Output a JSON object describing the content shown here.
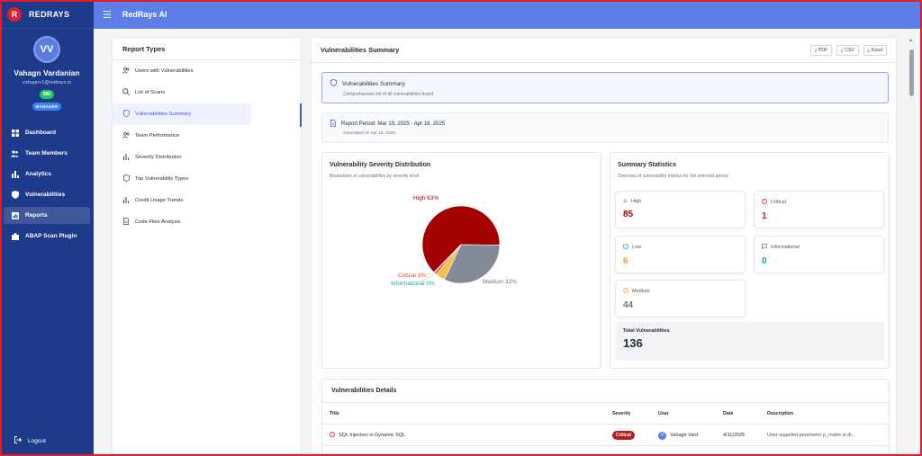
{
  "brand": {
    "logo_letter": "R",
    "name": "REDRAYS"
  },
  "topbar": {
    "title": "RedRays AI"
  },
  "user": {
    "initials": "VV",
    "name": "Vahagn Vardanian",
    "email": "vahagn+1@redrays.io",
    "badge": "S82",
    "role": "MANAGER"
  },
  "sidebar": {
    "items": [
      {
        "label": "Dashboard",
        "icon": "grid-icon"
      },
      {
        "label": "Team Members",
        "icon": "users-icon"
      },
      {
        "label": "Analytics",
        "icon": "bar-chart-icon"
      },
      {
        "label": "Vulnerabilities",
        "icon": "shield-icon"
      },
      {
        "label": "Reports",
        "icon": "report-icon"
      },
      {
        "label": "ABAP Scan Plugin",
        "icon": "puzzle-icon"
      }
    ],
    "logout": "Logout"
  },
  "report_types": {
    "title": "Report Types",
    "items": [
      {
        "label": "Users with Vulnerabilities",
        "icon": "users-icon"
      },
      {
        "label": "List of Scans",
        "icon": "search-icon"
      },
      {
        "label": "Vulnerabilities Summary",
        "icon": "shield-icon"
      },
      {
        "label": "Team Performance",
        "icon": "users-icon"
      },
      {
        "label": "Severity Distribution",
        "icon": "bar-chart-icon"
      },
      {
        "label": "Top Vulnerability Types",
        "icon": "shield-icon"
      },
      {
        "label": "Credit Usage Trends",
        "icon": "bar-chart-icon"
      },
      {
        "label": "Code Files Analysis",
        "icon": "file-icon"
      }
    ]
  },
  "main": {
    "title": "Vulnerabilities Summary",
    "exports": [
      "PDF",
      "CSV",
      "Excel"
    ],
    "info": {
      "title": "Vulnerabilities Summary",
      "subtitle": "Comprehensive list of all vulnerabilities found"
    },
    "period": {
      "title": "Report Period: Mar 19, 2025 - Apr 18, 2025",
      "generated": "Generated on Apr 18, 2025"
    }
  },
  "chart_card": {
    "title": "Vulnerability Severity Distribution",
    "subtitle": "Breakdown of vulnerabilities by severity level."
  },
  "chart_data": {
    "type": "pie",
    "slices": [
      {
        "label": "High 63%",
        "value": 63,
        "color": "#a30000"
      },
      {
        "label": "Medium 32%",
        "value": 32,
        "color": "#858a99"
      },
      {
        "label": "Low",
        "value": 4,
        "color": "#f5c04a"
      },
      {
        "label": "Critical 1%",
        "value": 1,
        "color": "#e53e3e"
      },
      {
        "label": "Informational 0%",
        "value": 0.3,
        "color": "#17a2b8"
      }
    ]
  },
  "stats": {
    "title": "Summary Statistics",
    "subtitle": "Overview of vulnerability metrics for the selected period.",
    "items": [
      {
        "label": "High",
        "value": "85",
        "color": "#a30000",
        "icon": "warning-icon"
      },
      {
        "label": "Critical",
        "value": "1",
        "color": "#b91c1c",
        "icon": "alert-circle-icon"
      },
      {
        "label": "Low",
        "value": "6",
        "color": "#e8a317",
        "icon": "info-icon"
      },
      {
        "label": "Informational",
        "value": "0",
        "color": "#17a2b8",
        "icon": "message-icon"
      },
      {
        "label": "Medium",
        "value": "44",
        "color": "#6b7280",
        "icon": "alert-circle-icon"
      }
    ],
    "total_label": "Total Vulnerabilities",
    "total_value": "136"
  },
  "details": {
    "title": "Vulnerabilities Details",
    "headers": [
      "Title",
      "Severity",
      "User",
      "Date",
      "Description"
    ],
    "rows": [
      {
        "title": "SQL Injection in Dynamic SQL",
        "severity": "Critical",
        "user_initial": "V",
        "user": "Vahagn Vard",
        "date": "4/11/2025",
        "description": "User-supplied parameter p_matnr is di..."
      }
    ]
  }
}
